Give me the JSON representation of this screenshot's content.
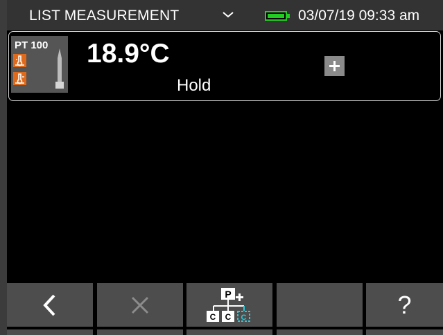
{
  "status_bar": {
    "title": "LIST MEASUREMENT",
    "datetime": "03/07/19 09:33 am",
    "battery_color": "#22cc22"
  },
  "channel": {
    "sensor": "PT 100",
    "reading": "18.9°C",
    "mode": "Hold",
    "accent": "#e06a1c"
  },
  "softkeys": {
    "back_icon": "chevron-left-icon",
    "clear_icon": "close-icon",
    "hierarchy_icon": "probe-hierarchy-icon",
    "empty": "",
    "help_label": "?"
  }
}
